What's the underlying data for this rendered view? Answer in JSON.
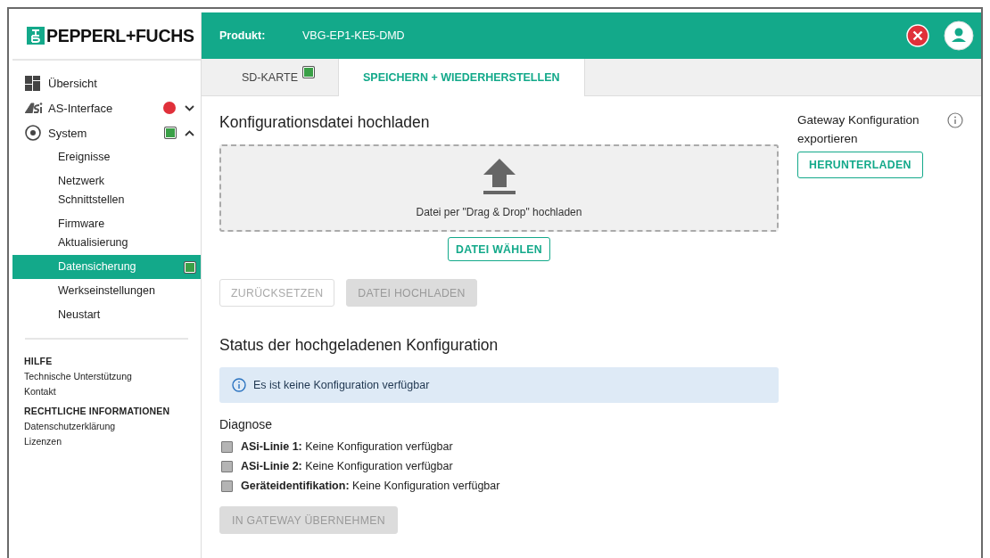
{
  "logo": {
    "text": "PEPPERL+FUCHS"
  },
  "header": {
    "label": "Produkt:",
    "value": "VBG-EP1-KE5-DMD"
  },
  "nav": [
    {
      "label": "Übersicht",
      "selected": false
    },
    {
      "label": "AS-Interface",
      "selected": false,
      "expanded": false,
      "indicator": {
        "kind": "circle",
        "color": "#e0303a"
      }
    },
    {
      "label": "System",
      "selected": false,
      "expanded": true,
      "indicator": {
        "kind": "square",
        "color": "#3aa047"
      },
      "children": [
        {
          "label": "Ereignisse",
          "selected": false
        },
        {
          "label": "Netzwerk\nSchnittstellen",
          "selected": false
        },
        {
          "label": "Firmware\nAktualisierung",
          "selected": false
        },
        {
          "label": "Datensicherung",
          "selected": true,
          "indicator": {
            "kind": "square",
            "color": "#3aa047"
          }
        },
        {
          "label": "Werkseinstellungen",
          "selected": false
        },
        {
          "label": "Neustart",
          "selected": false
        }
      ]
    }
  ],
  "footer": [
    {
      "heading": "HILFE",
      "links": [
        "Technische Unterstützung",
        "Kontakt"
      ]
    },
    {
      "heading": "RECHTLICHE INFORMATIONEN",
      "links": [
        "Datenschutzerklärung",
        "Lizenzen"
      ]
    }
  ],
  "tabs": [
    {
      "label": "SD-KARTE",
      "selected": false,
      "indicator": {
        "kind": "square",
        "color": "#3aa047"
      }
    },
    {
      "label": "SPEICHERN + WIEDERHERSTELLEN",
      "selected": true
    }
  ],
  "upload": {
    "title": "Konfigurationsdatei hochladen",
    "dropzone": "Datei per \"Drag & Drop\" hochladen",
    "choose_button": "DATEI WÄHLEN",
    "buttons": [
      {
        "label": "ZURÜCKSETZEN",
        "kind": "outlined",
        "disabled": true
      },
      {
        "label": "DATEI HOCHLADEN",
        "kind": "filled",
        "disabled": true
      }
    ]
  },
  "status": {
    "title": "Status der hochgeladenen Konfiguration",
    "info": "Es ist keine Konfiguration verfügbar",
    "diagnose_title": "Diagnose",
    "items": [
      {
        "text": "**ASi-Linie 1:** Keine Konfiguration verfügbar",
        "color": "#b4b4b4"
      },
      {
        "text": "**ASi-Linie 2:** Keine Konfiguration verfügbar",
        "color": "#b4b4b4"
      },
      {
        "text": "**Geräteidentifikation:** Keine Konfiguration verfügbar",
        "color": "#b4b4b4"
      }
    ],
    "apply_button": {
      "label": "IN GATEWAY ÜBERNEHMEN",
      "disabled": true
    }
  },
  "export": {
    "title": "Gateway Konfiguration exportieren",
    "button": "HERUNTERLADEN"
  }
}
